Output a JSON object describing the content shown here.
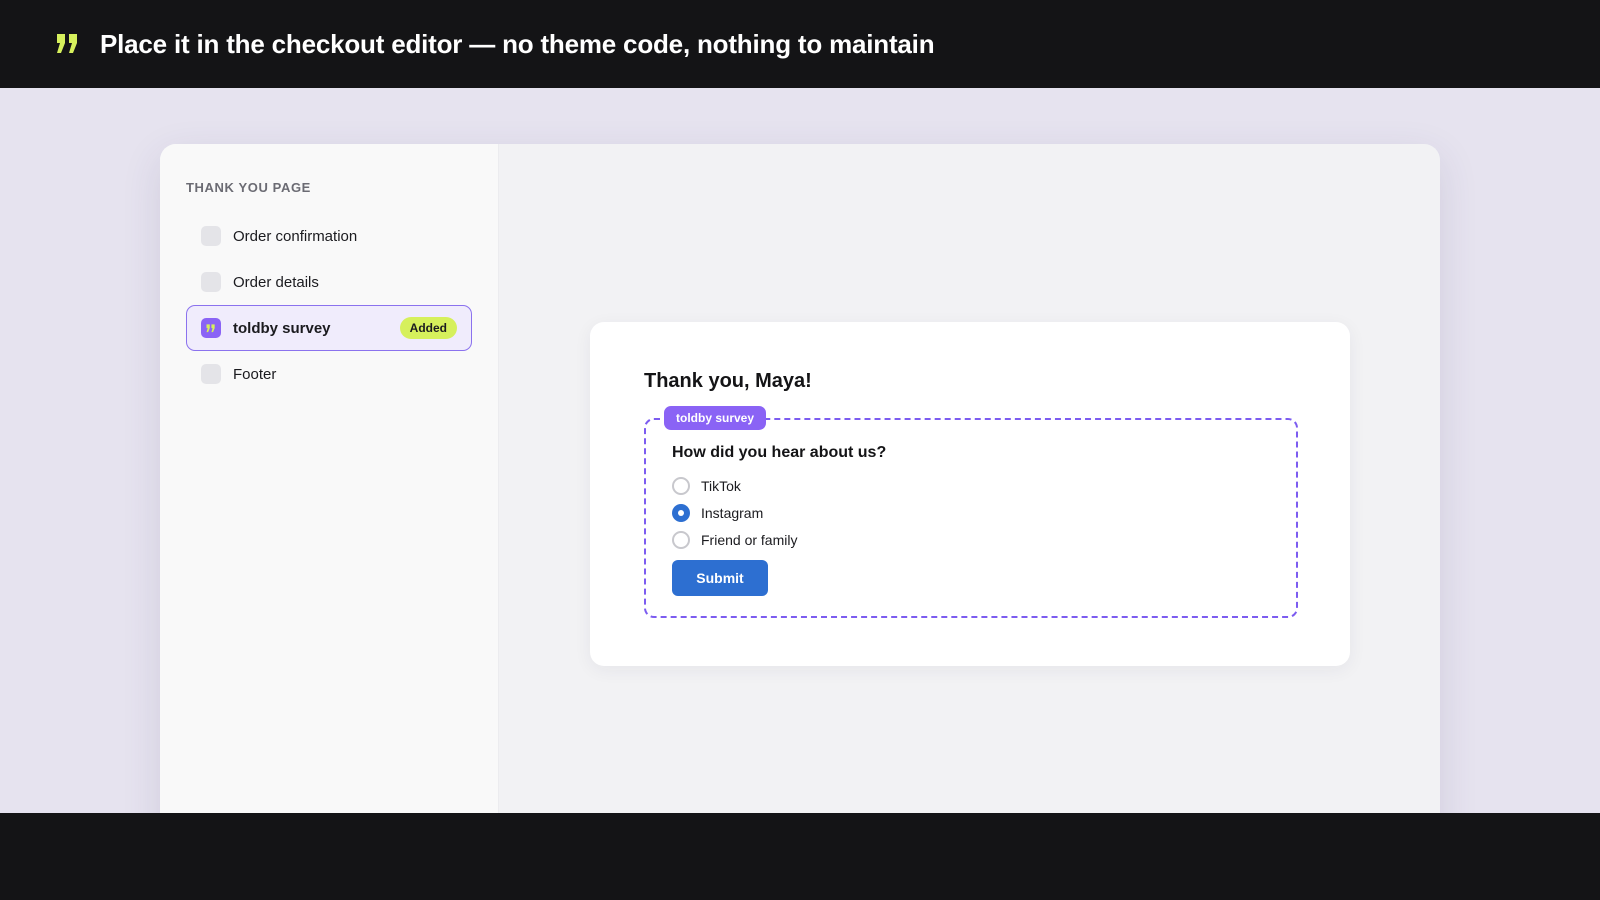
{
  "header": {
    "headline": "Place it in the checkout editor — no theme code, nothing to maintain",
    "icon": "quote-icon"
  },
  "sidebar": {
    "title": "THANK YOU PAGE",
    "items": [
      {
        "label": "Order confirmation"
      },
      {
        "label": "Order details"
      },
      {
        "label": "toldby survey",
        "badge": "Added",
        "active": true
      },
      {
        "label": "Footer"
      }
    ]
  },
  "preview": {
    "title": "Thank you, Maya!",
    "survey_tag": "toldby survey",
    "question": "How did you hear about us?",
    "options": [
      {
        "label": "TikTok",
        "selected": false
      },
      {
        "label": "Instagram",
        "selected": true
      },
      {
        "label": "Friend or family",
        "selected": false
      }
    ],
    "submit_label": "Submit"
  },
  "colors": {
    "accent_lime": "#d6f05c",
    "accent_purple": "#8a63f5",
    "button_blue": "#2d6fd1",
    "dark_bg": "#141416"
  }
}
